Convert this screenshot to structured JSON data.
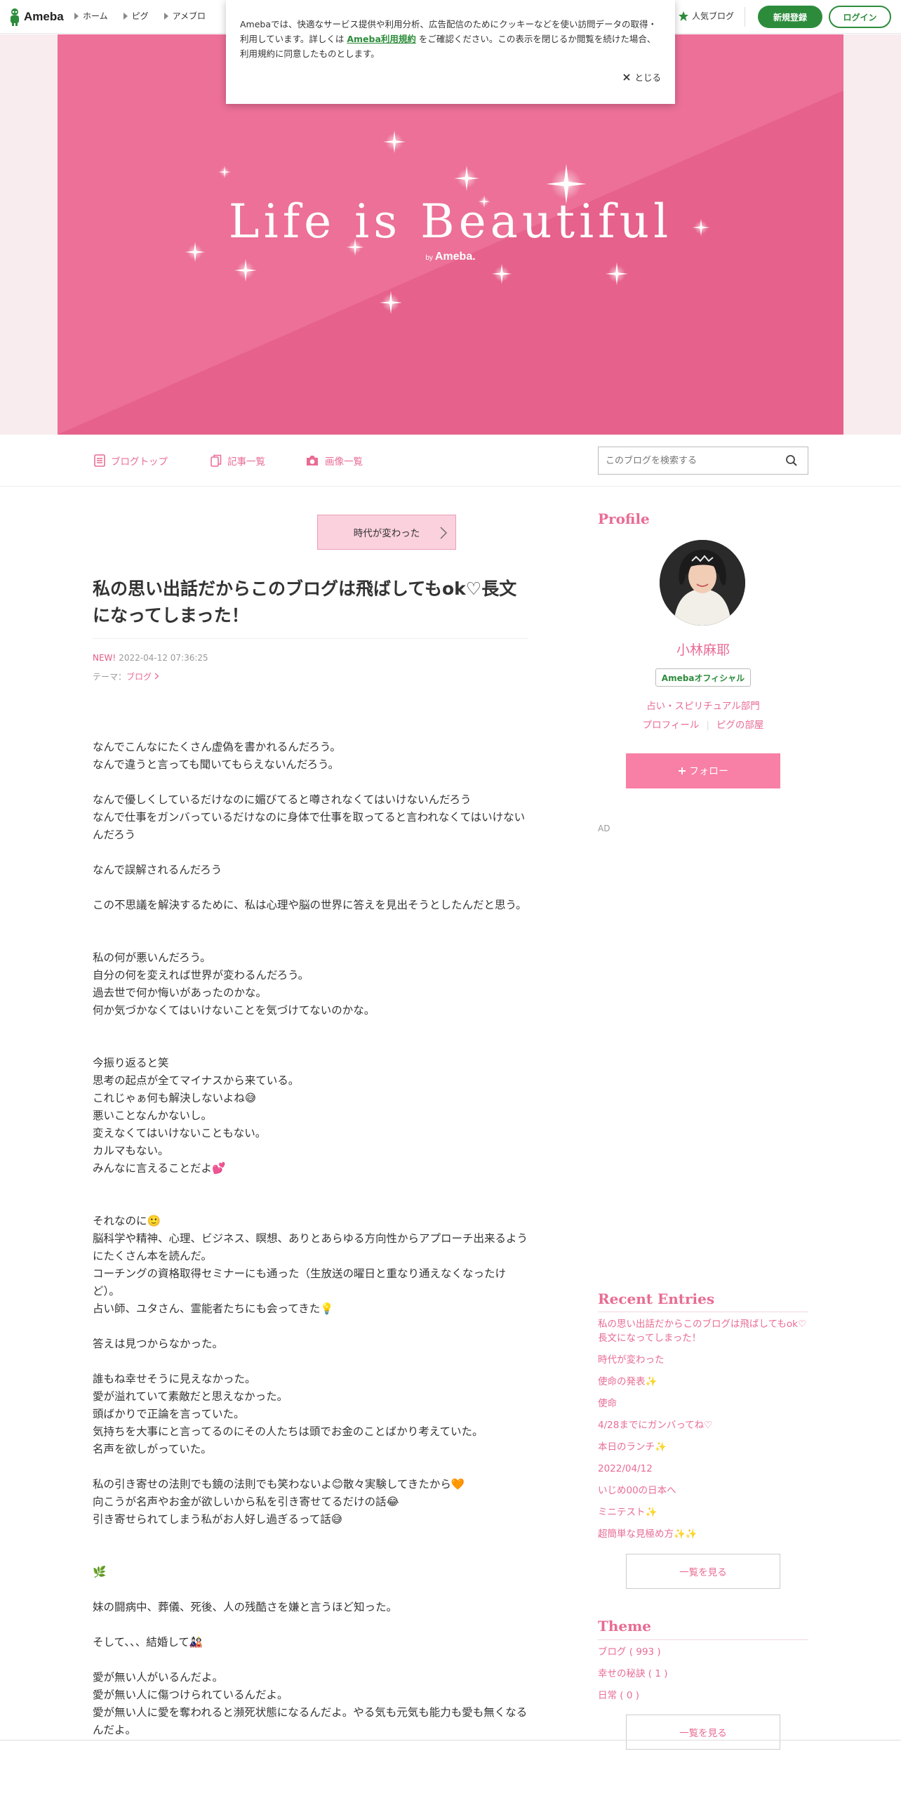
{
  "topbar": {
    "logo_text": "Ameba",
    "nav": [
      "ホーム",
      "ピグ",
      "アメブロ"
    ],
    "popular_label": "人気ブログ",
    "register_label": "新規登録",
    "login_label": "ログイン",
    "brand_color": "#2d8c3c"
  },
  "cookie": {
    "text_before": "Amebaでは、快適なサービス提供や利用分析、広告配信のためにクッキーなどを使い訪問データの取得・利用しています。詳しくは ",
    "link_text": "Ameba利用規約",
    "text_after": " をご確認ください。この表示を閉じるか閲覧を続けた場合、利用規約に同意したものとします。",
    "close_label": "とじる"
  },
  "header": {
    "title": "Life is Beautiful",
    "by_small": "by",
    "by_brand": "Ameba.",
    "bg_color": "#e8658e"
  },
  "blognav": {
    "items": [
      "ブログトップ",
      "記事一覧",
      "画像一覧"
    ],
    "search_placeholder": "このブログを検索する"
  },
  "article": {
    "prev_label": "時代が変わった",
    "title": "私の思い出話だからこのブログは飛ばしてもok♡長文になってしまった！",
    "new_badge": "NEW!",
    "date": "2022-04-12 07:36:25",
    "theme_label": "テーマ：",
    "theme_value": "ブログ",
    "body": [
      "",
      "なんでこんなにたくさん虚偽を書かれるんだろう。",
      "なんで違うと言っても聞いてもらえないんだろう。",
      "",
      "なんで優しくしているだけなのに媚びてると噂されなくてはいけないんだろう",
      "なんで仕事をガンバっているだけなのに身体で仕事を取ってると言われなくてはいけないんだろう",
      "",
      "なんで誤解されるんだろう",
      "",
      "この不思議を解決するために、私は心理や脳の世界に答えを見出そうとしたんだと思う。",
      "",
      "",
      "私の何が悪いんだろう。",
      "自分の何を変えれば世界が変わるんだろう。",
      "過去世で何か悔いがあったのかな。",
      "何か気づかなくてはいけないことを気づけてないのかな。",
      "",
      "",
      "今振り返ると笑",
      "思考の起点が全てマイナスから来ている。",
      "これじゃぁ何も解決しないよね😅",
      "悪いことなんかないし。",
      "変えなくてはいけないこともない。",
      "カルマもない。",
      "みんなに言えることだよ💕",
      "",
      "",
      "それなのに🙂",
      "脳科学や精神、心理、ビジネス、瞑想、ありとあらゆる方向性からアプローチ出来るようにたくさん本を読んだ。",
      "コーチングの資格取得セミナーにも通った（生放送の曜日と重なり通えなくなったけど）。",
      "占い師、ユタさん、霊能者たちにも会ってきた💡",
      "",
      "答えは見つからなかった。",
      "",
      "誰もね幸せそうに見えなかった。",
      "愛が溢れていて素敵だと思えなかった。",
      "頭ばかりで正論を言っていた。",
      "気持ちを大事にと言ってるのにその人たちは頭でお金のことばかり考えていた。",
      "名声を欲しがっていた。",
      "",
      "私の引き寄せの法則でも鏡の法則でも笑わないよ😊散々実験してきたから🧡",
      "向こうが名声やお金が欲しいから私を引き寄せてるだけの話😂",
      "引き寄せられてしまう私がお人好し過ぎるって話😅",
      "",
      "",
      "🌿",
      "",
      "妹の闘病中、葬儀、死後、人の残酷さを嫌と言うほど知った。",
      "",
      "そして、、、結婚して🎎",
      "",
      "愛が無い人がいるんだよ。",
      "愛が無い人に傷つけられているんだよ。",
      "愛が無い人に愛を奪われると瀕死状態になるんだよ。やる気も元気も能力も愛も無くなるんだよ。"
    ]
  },
  "sidebar": {
    "profile_heading": "Profile",
    "name": "小林麻耶",
    "official_label": "Amebaオフィシャル",
    "category": "占い・スピリチュアル部門",
    "links": [
      "プロフィール",
      "ピグの部屋"
    ],
    "follow_label": "フォロー",
    "ad_label": "AD",
    "recent_heading": "Recent Entries",
    "recent": [
      "私の思い出話だからこのブログは飛ばしてもok♡長文になってしまった！",
      "時代が変わった",
      "使命の発表✨",
      "使命",
      "4/28までにガンバってね♡",
      "本日のランチ✨",
      "2022/04/12",
      "いじめ00の日本へ",
      "ミニテスト✨",
      "超簡単な見極め方✨✨"
    ],
    "more_label": "一覧を見る",
    "theme_heading": "Theme",
    "themes": [
      "ブログ ( 993 )",
      "幸せの秘訣 ( 1 )",
      "日常 ( 0 )"
    ],
    "accent_color": "#e86c94"
  }
}
